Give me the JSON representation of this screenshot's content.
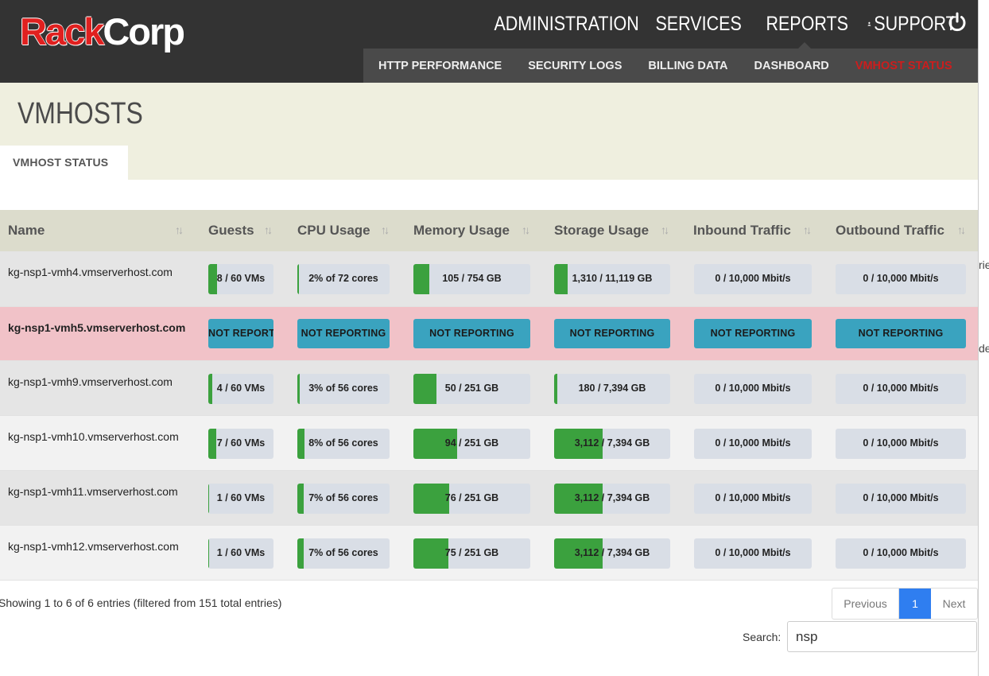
{
  "brand": {
    "logo_part1": "Rack",
    "logo_part2": "Corp"
  },
  "main_nav": [
    {
      "label": "ADMINISTRATION",
      "icon": "gear-icon"
    },
    {
      "label": "SERVICES",
      "icon": "tools-icon"
    },
    {
      "label": "REPORTS",
      "icon": "bar-chart-icon"
    },
    {
      "label": "SUPPORT",
      "icon": "user-icon"
    }
  ],
  "sub_nav": [
    {
      "label": "HTTP PERFORMANCE",
      "active": false
    },
    {
      "label": "SECURITY LOGS",
      "active": false
    },
    {
      "label": "BILLING DATA",
      "active": false
    },
    {
      "label": "DASHBOARD",
      "active": false
    },
    {
      "label": "VMHOST STATUS",
      "active": true
    }
  ],
  "page": {
    "title": "VMHOSTS",
    "tab": "VMHOST STATUS"
  },
  "table": {
    "columns": [
      "Name",
      "Guests",
      "CPU Usage",
      "Memory Usage",
      "Storage Usage",
      "Inbound Traffic",
      "Outbound Traffic"
    ],
    "rows": [
      {
        "name": "kg-nsp1-vmh4.vmserverhost.com",
        "status": "ok",
        "guests": {
          "text": "8 / 60 VMs",
          "pct": 0.133
        },
        "cpu": {
          "text": "2% of 72 cores",
          "pct": 0.02
        },
        "memory": {
          "text": "105 / 754 GB",
          "pct": 0.139
        },
        "storage": {
          "text": "1,310 / 11,119 GB",
          "pct": 0.118
        },
        "inbound": {
          "text": "0 / 10,000 Mbit/s",
          "pct": 0
        },
        "outbound": {
          "text": "0 / 10,000 Mbit/s",
          "pct": 0
        }
      },
      {
        "name": "kg-nsp1-vmh5.vmserverhost.com",
        "status": "not_reporting",
        "guests": {
          "text": "NOT REPORTING"
        },
        "cpu": {
          "text": "NOT REPORTING"
        },
        "memory": {
          "text": "NOT REPORTING"
        },
        "storage": {
          "text": "NOT REPORTING"
        },
        "inbound": {
          "text": "NOT REPORTING"
        },
        "outbound": {
          "text": "NOT REPORTING"
        }
      },
      {
        "name": "kg-nsp1-vmh9.vmserverhost.com",
        "status": "ok",
        "guests": {
          "text": "4 / 60 VMs",
          "pct": 0.067
        },
        "cpu": {
          "text": "3% of 56 cores",
          "pct": 0.03
        },
        "memory": {
          "text": "50 / 251 GB",
          "pct": 0.199
        },
        "storage": {
          "text": "180 / 7,394 GB",
          "pct": 0.024
        },
        "inbound": {
          "text": "0 / 10,000 Mbit/s",
          "pct": 0
        },
        "outbound": {
          "text": "0 / 10,000 Mbit/s",
          "pct": 0
        }
      },
      {
        "name": "kg-nsp1-vmh10.vmserverhost.com",
        "status": "ok",
        "guests": {
          "text": "7 / 60 VMs",
          "pct": 0.117
        },
        "cpu": {
          "text": "8% of 56 cores",
          "pct": 0.08
        },
        "memory": {
          "text": "94 / 251 GB",
          "pct": 0.375
        },
        "storage": {
          "text": "3,112 / 7,394 GB",
          "pct": 0.421
        },
        "inbound": {
          "text": "0 / 10,000 Mbit/s",
          "pct": 0
        },
        "outbound": {
          "text": "0 / 10,000 Mbit/s",
          "pct": 0
        }
      },
      {
        "name": "kg-nsp1-vmh11.vmserverhost.com",
        "status": "ok",
        "guests": {
          "text": "1 / 60 VMs",
          "pct": 0.017
        },
        "cpu": {
          "text": "7% of 56 cores",
          "pct": 0.07
        },
        "memory": {
          "text": "76 / 251 GB",
          "pct": 0.303
        },
        "storage": {
          "text": "3,112 / 7,394 GB",
          "pct": 0.421
        },
        "inbound": {
          "text": "0 / 10,000 Mbit/s",
          "pct": 0
        },
        "outbound": {
          "text": "0 / 10,000 Mbit/s",
          "pct": 0
        }
      },
      {
        "name": "kg-nsp1-vmh12.vmserverhost.com",
        "status": "ok",
        "guests": {
          "text": "1 / 60 VMs",
          "pct": 0.017
        },
        "cpu": {
          "text": "7% of 56 cores",
          "pct": 0.07
        },
        "memory": {
          "text": "75 / 251 GB",
          "pct": 0.299
        },
        "storage": {
          "text": "3,112 / 7,394 GB",
          "pct": 0.421
        },
        "inbound": {
          "text": "0 / 10,000 Mbit/s",
          "pct": 0
        },
        "outbound": {
          "text": "0 / 10,000 Mbit/s",
          "pct": 0
        }
      }
    ]
  },
  "footer": {
    "info": "Showing 1 to 6 of 6 entries (filtered from 151 total entries)",
    "pagination": {
      "previous": "Previous",
      "current": "1",
      "next": "Next"
    },
    "search_label": "Search:",
    "search_value": "nsp"
  },
  "right_edge_text": [
    "rie",
    "de"
  ],
  "colors": {
    "topbar": "#333333",
    "accent_red": "#cc1d1d",
    "bar_fill": "#3ba13e",
    "not_reporting": "#3aa3bf",
    "title_bg": "#efefdf",
    "header_bg": "#dcdccc",
    "error_row": "#f1c2c8",
    "page_active": "#2f7ef0"
  }
}
